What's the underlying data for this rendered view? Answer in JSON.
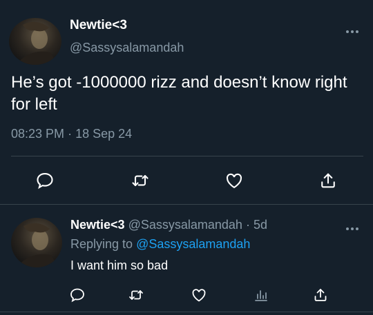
{
  "main_tweet": {
    "author_name": "Newtie<3",
    "author_handle": "@Sassysalamandah",
    "text": "He’s got -1000000 rizz and doesn’t know right for left",
    "time": "08:23 PM",
    "separator": "·",
    "date": "18 Sep 24",
    "actions": [
      "comment-icon",
      "retweet-icon",
      "like-icon",
      "share-icon"
    ]
  },
  "reply_tweet": {
    "author_name": "Newtie<3",
    "author_handle": "@Sassysalamandah",
    "separator": "·",
    "age": "5d",
    "replying_prefix": "Replying to",
    "replying_to": "@Sassysalamandah",
    "text": "I want him so bad",
    "actions": [
      "comment-icon",
      "retweet-icon",
      "like-icon",
      "analytics-icon",
      "share-icon"
    ]
  },
  "colors": {
    "background": "#15202b",
    "text": "#ffffff",
    "secondary": "#8899a6",
    "accent": "#1da1f2",
    "divider": "#38444d"
  }
}
